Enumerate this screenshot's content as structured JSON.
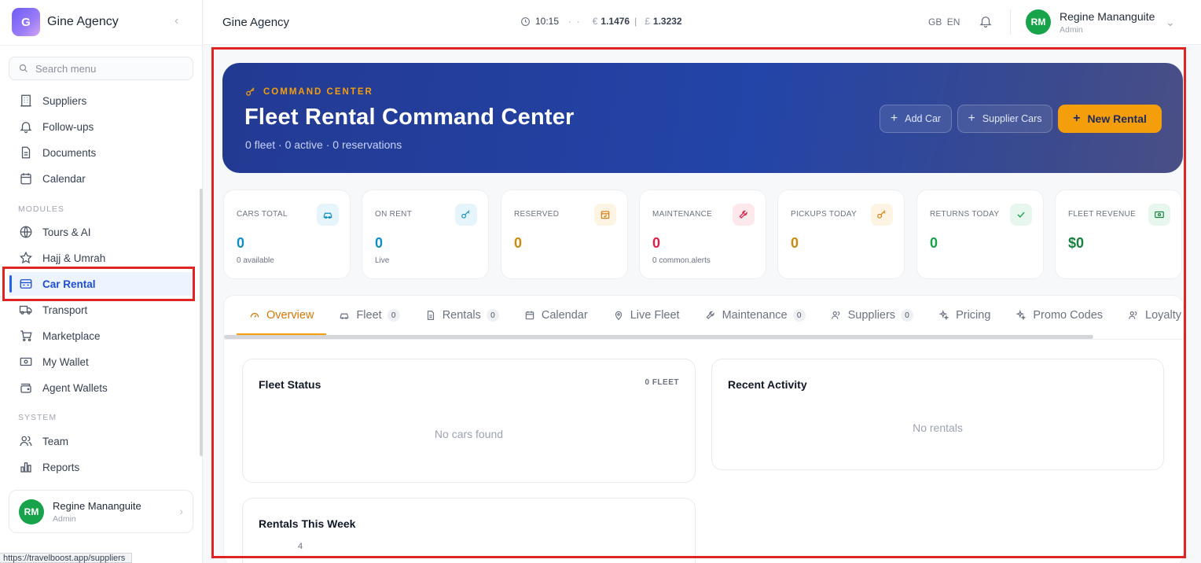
{
  "brand": {
    "initial": "G",
    "name": "Gine Agency"
  },
  "search": {
    "placeholder": "Search menu"
  },
  "nav": {
    "main": [
      "Suppliers",
      "Follow-ups",
      "Documents",
      "Calendar"
    ],
    "modules_label": "MODULES",
    "modules": [
      "Tours & AI",
      "Hajj & Umrah",
      "Car Rental",
      "Transport",
      "Marketplace",
      "My Wallet",
      "Agent Wallets"
    ],
    "system_label": "SYSTEM",
    "system": [
      "Team",
      "Reports"
    ],
    "active": "Car Rental"
  },
  "user": {
    "initials": "RM",
    "name": "Regine Mananguite",
    "role": "Admin"
  },
  "status_url": "https://travelboost.app/suppliers",
  "topbar": {
    "title": "Gine Agency",
    "time": "10:15",
    "eur_symbol": "€",
    "eur_rate": "1.1476",
    "gbp_symbol": "£",
    "gbp_rate": "1.3232",
    "lang_code": "GB",
    "lang": "EN"
  },
  "hero": {
    "kicker": "COMMAND CENTER",
    "title": "Fleet Rental Command Center",
    "subtitle": "0 fleet · 0 active · 0 reservations",
    "btn_add_car": "Add Car",
    "btn_supplier_cars": "Supplier Cars",
    "btn_new_rental": "New Rental"
  },
  "stats": [
    {
      "label": "CARS TOTAL",
      "value": "0",
      "sub": "0 available",
      "color": "#0e8fc4",
      "icon": "car-icon"
    },
    {
      "label": "ON RENT",
      "value": "0",
      "sub": "Live",
      "color": "#0e8fc4",
      "icon": "key-icon"
    },
    {
      "label": "RESERVED",
      "value": "0",
      "sub": "",
      "color": "#c98a0d",
      "icon": "calendar-check-icon"
    },
    {
      "label": "MAINTENANCE",
      "value": "0",
      "sub": "0 common.alerts",
      "color": "#e11d48",
      "icon": "wrench-icon"
    },
    {
      "label": "PICKUPS TODAY",
      "value": "0",
      "sub": "",
      "color": "#c98a0d",
      "icon": "key-icon"
    },
    {
      "label": "RETURNS TODAY",
      "value": "0",
      "sub": "",
      "color": "#16a34a",
      "icon": "check-icon"
    },
    {
      "label": "FLEET REVENUE",
      "value": "$0",
      "sub": "",
      "color": "#15803d",
      "icon": "cash-icon"
    }
  ],
  "tabs": [
    {
      "label": "Overview",
      "badge": ""
    },
    {
      "label": "Fleet",
      "badge": "0"
    },
    {
      "label": "Rentals",
      "badge": "0"
    },
    {
      "label": "Calendar",
      "badge": ""
    },
    {
      "label": "Live Fleet",
      "badge": ""
    },
    {
      "label": "Maintenance",
      "badge": "0"
    },
    {
      "label": "Suppliers",
      "badge": "0"
    },
    {
      "label": "Pricing",
      "badge": ""
    },
    {
      "label": "Promo Codes",
      "badge": ""
    },
    {
      "label": "Loyalty",
      "badge": ""
    }
  ],
  "fleet_status": {
    "title": "Fleet Status",
    "meta": "0 FLEET",
    "empty": "No cars found"
  },
  "recent_activity": {
    "title": "Recent Activity",
    "empty": "No rentals"
  },
  "rentals_week": {
    "title": "Rentals This Week",
    "tick": "4"
  }
}
